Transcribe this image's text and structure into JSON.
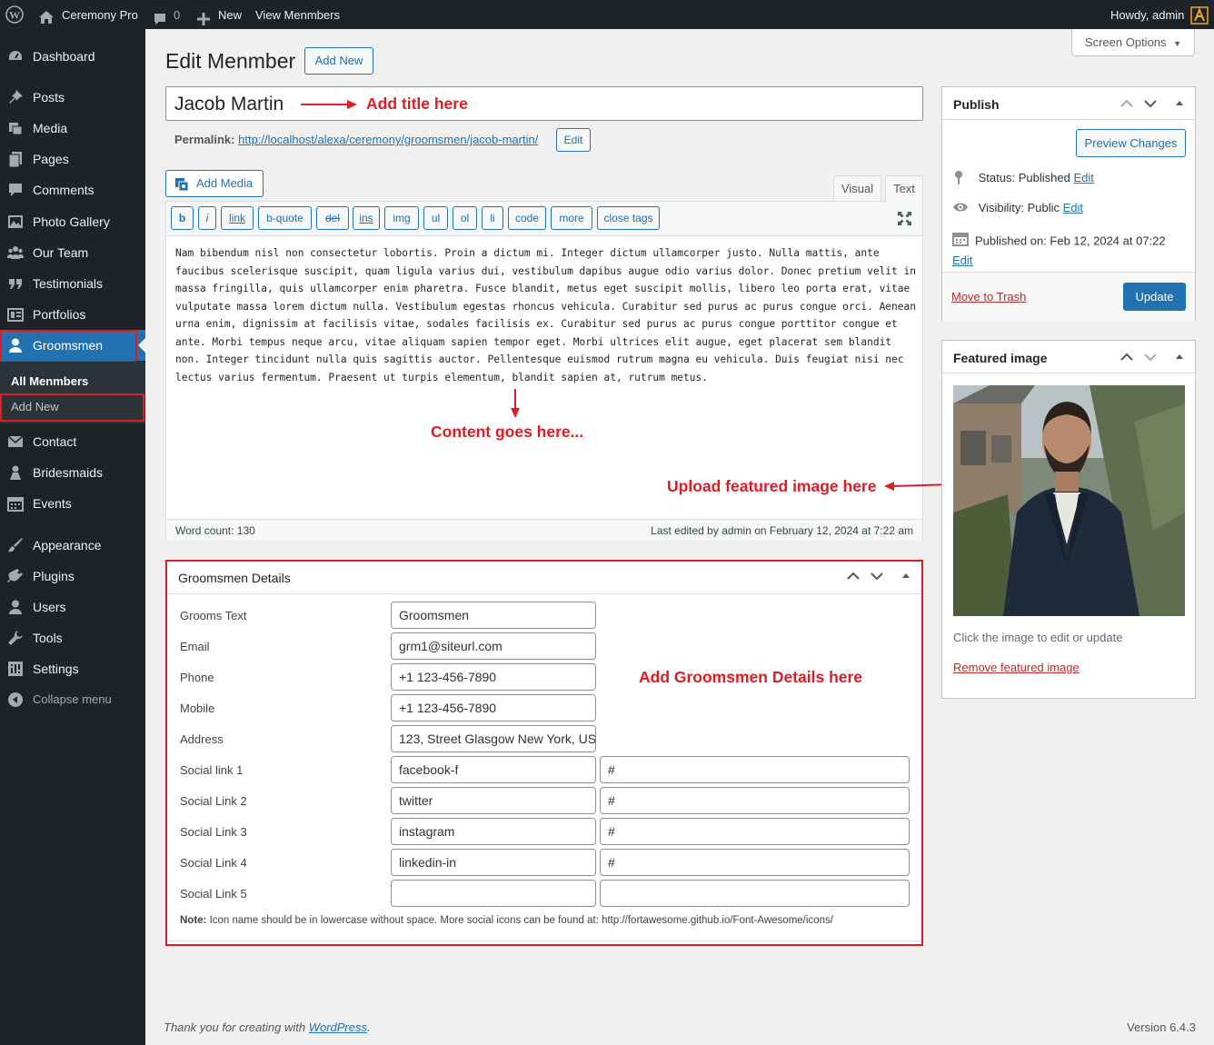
{
  "adminbar": {
    "site_name": "Ceremony Pro",
    "comments_count": "0",
    "new_label": "New",
    "view_label": "View Menmbers",
    "howdy": "Howdy, admin"
  },
  "sidebar": {
    "items": [
      "Dashboard",
      "Posts",
      "Media",
      "Pages",
      "Comments",
      "Photo Gallery",
      "Our Team",
      "Testimonials",
      "Portfolios",
      "Groomsmen",
      "Contact",
      "Bridesmaids",
      "Events",
      "Appearance",
      "Plugins",
      "Users",
      "Tools",
      "Settings",
      "Collapse menu"
    ],
    "submenu": [
      "All Menmbers",
      "Add New"
    ]
  },
  "screen_options": "Screen Options",
  "page": {
    "title": "Edit Menmber",
    "add_new": "Add New"
  },
  "post": {
    "title": "Jacob Martin",
    "permalink_label": "Permalink:",
    "permalink_url": "http://localhost/alexa/ceremony/groomsmen/jacob-martin/",
    "permalink_edit": "Edit"
  },
  "editor": {
    "add_media": "Add Media",
    "tab_visual": "Visual",
    "tab_text": "Text",
    "quicktags": [
      "b",
      "i",
      "link",
      "b-quote",
      "del",
      "ins",
      "img",
      "ul",
      "ol",
      "li",
      "code",
      "more",
      "close tags"
    ],
    "content": "Nam bibendum nisl non consectetur lobortis. Proin a dictum mi. Integer dictum ullamcorper justo. Nulla mattis, ante faucibus scelerisque suscipit, quam ligula varius dui, vestibulum dapibus augue odio varius dolor. Donec pretium velit in massa fringilla, quis ullamcorper enim pharetra. Fusce blandit, metus eget suscipit mollis, libero leo porta erat, vitae vulputate massa lorem dictum nulla. Vestibulum egestas rhoncus vehicula. Curabitur sed purus ac purus congue orci. Aenean urna enim, dignissim at facilisis vitae, sodales facilisis ex. Curabitur sed purus ac purus congue porttitor congue et ante. Morbi tempus neque arcu, vitae aliquam sapien tempor eget. Morbi ultrices elit augue, eget placerat sem blandit non. Integer tincidunt nulla quis sagittis auctor. Pellentesque euismod rutrum magna eu vehicula. Duis feugiat nisi nec lectus varius fermentum. Praesent ut turpis elementum, blandit sapien at, rutrum metus.",
    "word_count": "Word count: 130",
    "last_edited": "Last edited by admin on February 12, 2024 at 7:22 am"
  },
  "annotations": {
    "title": "Add title here",
    "content": "Content goes here...",
    "featured": "Upload featured image here",
    "details": "Add Groomsmen Details here"
  },
  "groomsmen": {
    "heading": "Groomsmen Details",
    "fields": [
      {
        "label": "Grooms Text",
        "value": "Groomsmen"
      },
      {
        "label": "Email",
        "value": "grm1@siteurl.com"
      },
      {
        "label": "Phone",
        "value": "+1 123-456-7890"
      },
      {
        "label": "Mobile",
        "value": "+1 123-456-7890"
      },
      {
        "label": "Address",
        "value": "123, Street Glasgow New York, US"
      }
    ],
    "social": [
      {
        "label": "Social link 1",
        "icon": "facebook-f",
        "url": "#"
      },
      {
        "label": "Social Link 2",
        "icon": "twitter",
        "url": "#"
      },
      {
        "label": "Social Link 3",
        "icon": "instagram",
        "url": "#"
      },
      {
        "label": "Social Link 4",
        "icon": "linkedin-in",
        "url": "#"
      },
      {
        "label": "Social Link 5",
        "icon": "",
        "url": ""
      }
    ],
    "note_label": "Note:",
    "note_text": " Icon name should be in lowercase without space. More social icons can be found at: http://fortawesome.github.io/Font-Awesome/icons/"
  },
  "publish": {
    "heading": "Publish",
    "preview": "Preview Changes",
    "status_label": "Status:",
    "status_value": "Published",
    "status_edit": "Edit",
    "visibility_label": "Visibility:",
    "visibility_value": "Public",
    "visibility_edit": "Edit",
    "published_label": "Published on:",
    "published_value": "Feb 12, 2024 at 07:22",
    "published_edit": "Edit",
    "trash": "Move to Trash",
    "update": "Update"
  },
  "featured": {
    "heading": "Featured image",
    "hint": "Click the image to edit or update",
    "remove": "Remove featured image"
  },
  "footer": {
    "thanks_prefix": "Thank you for creating with ",
    "thanks_link": "WordPress",
    "thanks_suffix": ".",
    "version": "Version 6.4.3"
  },
  "colors": {
    "admin_dark": "#1d2327",
    "primary": "#2271b1",
    "annotation_red": "#e11b22",
    "background": "#f0f0f1"
  }
}
